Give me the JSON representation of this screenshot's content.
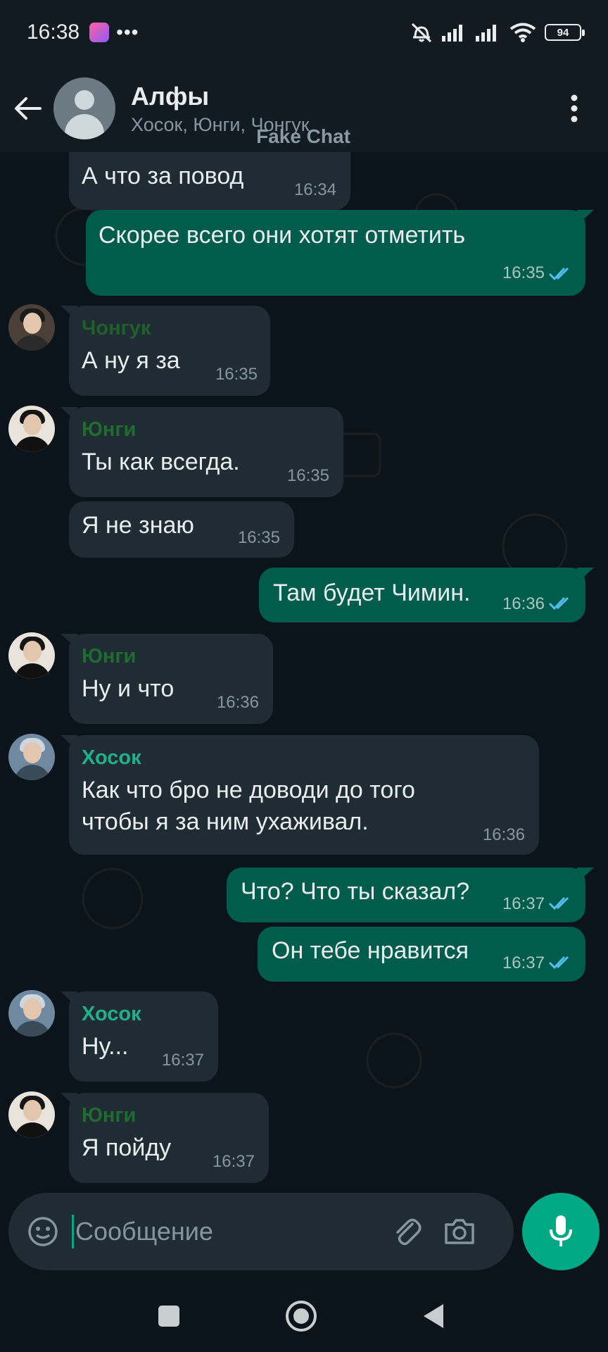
{
  "status_bar": {
    "time": "16:38",
    "battery": "94"
  },
  "header": {
    "title": "Алфы",
    "subtitle": "Хосок, Юнги, Чонгук",
    "watermark": "Fake Chat"
  },
  "colors": {
    "background": "#0b141a",
    "incoming_bubble": "#202c33",
    "outgoing_bubble": "#005c4b",
    "accent": "#00a884",
    "tick_blue": "#53bdeb",
    "sender_chonguk": "#1f5f2a",
    "sender_yungi": "#1f6b30",
    "sender_hosok": "#21b08a"
  },
  "messages": [
    {
      "direction": "in",
      "sender": "",
      "text": "А что за повод",
      "time": "16:34"
    },
    {
      "direction": "out",
      "sender": "",
      "text": "Скорее всего они хотят отметить",
      "time": "16:35",
      "status": "read"
    },
    {
      "direction": "in",
      "sender": "Чонгук",
      "text": "А ну я за",
      "time": "16:35"
    },
    {
      "direction": "in",
      "sender": "Юнги",
      "text": "Ты как всегда.",
      "time": "16:35"
    },
    {
      "direction": "in",
      "sender": "",
      "text": "Я не знаю",
      "time": "16:35"
    },
    {
      "direction": "out",
      "sender": "",
      "text": "Там будет Чимин.",
      "time": "16:36",
      "status": "read"
    },
    {
      "direction": "in",
      "sender": "Юнги",
      "text": "Ну и что",
      "time": "16:36"
    },
    {
      "direction": "in",
      "sender": "Хосок",
      "text": "Как что бро не доводи до того чтобы я за ним ухаживал.",
      "time": "16:36"
    },
    {
      "direction": "out",
      "sender": "",
      "text": "Что? Что ты сказал?",
      "time": "16:37",
      "status": "read"
    },
    {
      "direction": "out",
      "sender": "",
      "text": "Он тебе нравится",
      "time": "16:37",
      "status": "read"
    },
    {
      "direction": "in",
      "sender": "Хосок",
      "text": "Ну...",
      "time": "16:37"
    },
    {
      "direction": "in",
      "sender": "Юнги",
      "text": "Я пойду",
      "time": "16:37"
    }
  ],
  "composer": {
    "placeholder": "Сообщение",
    "value": ""
  },
  "icons": [
    "back-arrow-icon",
    "more-vert-icon",
    "emoji-icon",
    "attach-icon",
    "camera-icon",
    "mic-icon",
    "recents-icon",
    "home-icon",
    "back-nav-icon"
  ]
}
